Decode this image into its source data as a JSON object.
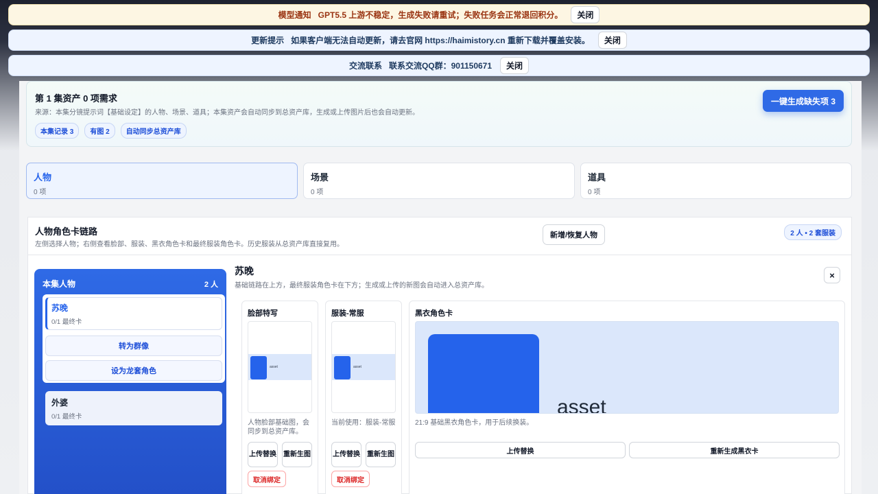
{
  "banners": {
    "model": {
      "label": "模型通知",
      "text": "GPT5.5 上游不稳定，生成失败请重试；失败任务会正常退回积分。",
      "close": "关闭"
    },
    "update": {
      "label": "更新提示",
      "text": "如果客户端无法自动更新，请去官网 https://haimistory.cn 重新下载并覆盖安装。",
      "close": "关闭"
    },
    "contact": {
      "label": "交流联系",
      "text": "联系交流QQ群：901150671",
      "close": "关闭"
    }
  },
  "summary": {
    "title": "第 1 集资产 0 项需求",
    "desc": "来源：本集分镜提示词【基础设定】的人物、场景、道具；本集资产会自动同步到总资产库，生成或上传图片后也会自动更新。",
    "chips": [
      "本集记录 3",
      "有图 2",
      "自动同步总资产库"
    ],
    "generate_button": "一键生成缺失项 3"
  },
  "tabs": [
    {
      "label": "人物",
      "count": "0 项",
      "active": true
    },
    {
      "label": "场景",
      "count": "0 项",
      "active": false
    },
    {
      "label": "道具",
      "count": "0 项",
      "active": false
    }
  ],
  "panel": {
    "title": "人物角色卡链路",
    "desc": "左侧选择人物；右侧查看脸部、服装、黑衣角色卡和最终服装角色卡。历史服装从总资产库直接复用。",
    "add_button": "新增/恢复人物",
    "badge": "2 人 • 2 套服装"
  },
  "char_list": {
    "title": "本集人物",
    "count": "2 人",
    "items": [
      {
        "name": "苏晚",
        "sub": "0/1 最终卡"
      },
      {
        "name": "外婆",
        "sub": "0/1 最终卡"
      }
    ],
    "actions": [
      "转为群像",
      "设为龙套角色"
    ]
  },
  "detail": {
    "name": "苏晚",
    "desc": "基础链路在上方，最终服装角色卡在下方；生成或上传的新图会自动进入总资产库。",
    "close_icon": "×",
    "face": {
      "title": "脸部特写",
      "thumb_label": "asset",
      "note": "人物脸部基础图，会同步到总资产库。",
      "upload": "上传替换",
      "regen": "重新生图",
      "unbind": "取消绑定"
    },
    "outfit": {
      "title": "服装-常服",
      "thumb_label": "asset",
      "note": "当前使用：服装-常服",
      "upload": "上传替换",
      "regen": "重新生图",
      "unbind": "取消绑定"
    },
    "black": {
      "title": "黑衣角色卡",
      "preview_label": "asset",
      "note": "21:9 基础黑衣角色卡，用于后续换装。",
      "upload": "上传替换",
      "regen": "重新生成黑衣卡"
    }
  },
  "colors": {
    "accent": "#2f6ae6",
    "danger": "#dc2626",
    "notice": "#9a3412"
  }
}
